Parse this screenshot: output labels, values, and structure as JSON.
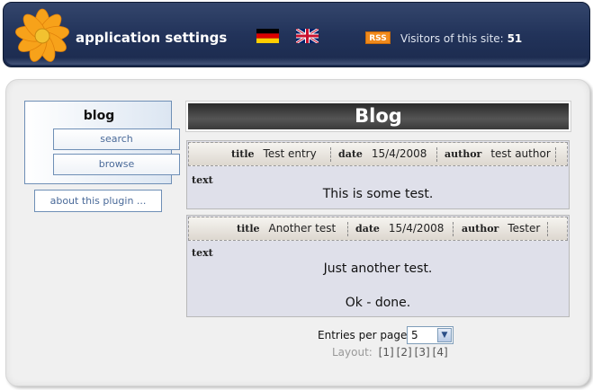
{
  "header": {
    "title": "application settings",
    "visitors_label": "Visitors of this site:",
    "visitors_count": "51",
    "rss_label": "RSS",
    "languages": [
      "german-flag",
      "english-flag"
    ]
  },
  "nav": {
    "title": "blog",
    "items": [
      {
        "label": "search"
      },
      {
        "label": "browse"
      }
    ],
    "about_label": "about this plugin ..."
  },
  "blog": {
    "heading": "Blog",
    "entries": [
      {
        "title_key": "title",
        "title": "Test entry",
        "date_key": "date",
        "date": "15/4/2008",
        "author_key": "author",
        "author": "test author",
        "text_key": "text",
        "lines": [
          "This is some test."
        ]
      },
      {
        "title_key": "title",
        "title": "Another test",
        "date_key": "date",
        "date": "15/4/2008",
        "author_key": "author",
        "author": "Tester",
        "text_key": "text",
        "lines": [
          "Just another test.",
          "Ok - done."
        ]
      }
    ]
  },
  "pagination": {
    "entries_per_page_label": "Entries per page",
    "entries_per_page_value": "5",
    "layout_label": "Layout:",
    "layouts": [
      "[1]",
      "[2]",
      "[3]",
      "[4]"
    ]
  },
  "colors": {
    "header_bg": "#22335a",
    "rss": "#f08a1c",
    "nav_border": "#6f8fb6",
    "entry_bg": "#dfe0ea"
  }
}
